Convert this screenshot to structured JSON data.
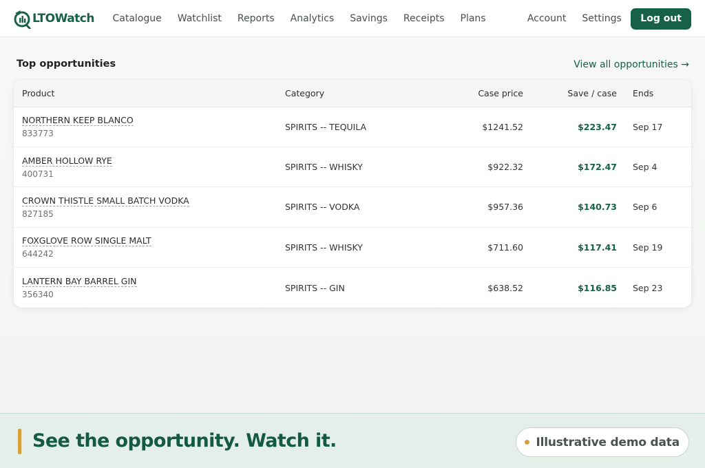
{
  "brand": {
    "name": "LTOWatch",
    "color": "#176149",
    "accent": "#d99f3a"
  },
  "nav": {
    "items": [
      "Catalogue",
      "Watchlist",
      "Reports",
      "Analytics",
      "Savings",
      "Receipts",
      "Plans"
    ],
    "right_items": [
      "Account",
      "Settings"
    ],
    "logout_label": "Log out"
  },
  "section": {
    "title": "Top opportunities",
    "view_all": "View all opportunities →"
  },
  "table": {
    "headers": {
      "product": "Product",
      "category": "Category",
      "case_price": "Case price",
      "save": "Save / case",
      "ends": "Ends"
    },
    "rows": [
      {
        "name": "NORTHERN KEEP BLANCO",
        "code": "833773",
        "category": "SPIRITS -- TEQUILA",
        "price": "$1241.52",
        "save": "$223.47",
        "ends": "Sep 17"
      },
      {
        "name": "AMBER HOLLOW RYE",
        "code": "400731",
        "category": "SPIRITS -- WHISKY",
        "price": "$922.32",
        "save": "$172.47",
        "ends": "Sep 4"
      },
      {
        "name": "CROWN THISTLE SMALL BATCH VODKA",
        "code": "827185",
        "category": "SPIRITS -- VODKA",
        "price": "$957.36",
        "save": "$140.73",
        "ends": "Sep 6"
      },
      {
        "name": "FOXGLOVE ROW SINGLE MALT",
        "code": "644242",
        "category": "SPIRITS -- WHISKY",
        "price": "$711.60",
        "save": "$117.41",
        "ends": "Sep 19"
      },
      {
        "name": "LANTERN BAY BARREL GIN",
        "code": "356340",
        "category": "SPIRITS -- GIN",
        "price": "$638.52",
        "save": "$116.85",
        "ends": "Sep 23"
      }
    ]
  },
  "banner": {
    "headline": "See the opportunity. Watch it.",
    "badge": "Illustrative demo data"
  }
}
